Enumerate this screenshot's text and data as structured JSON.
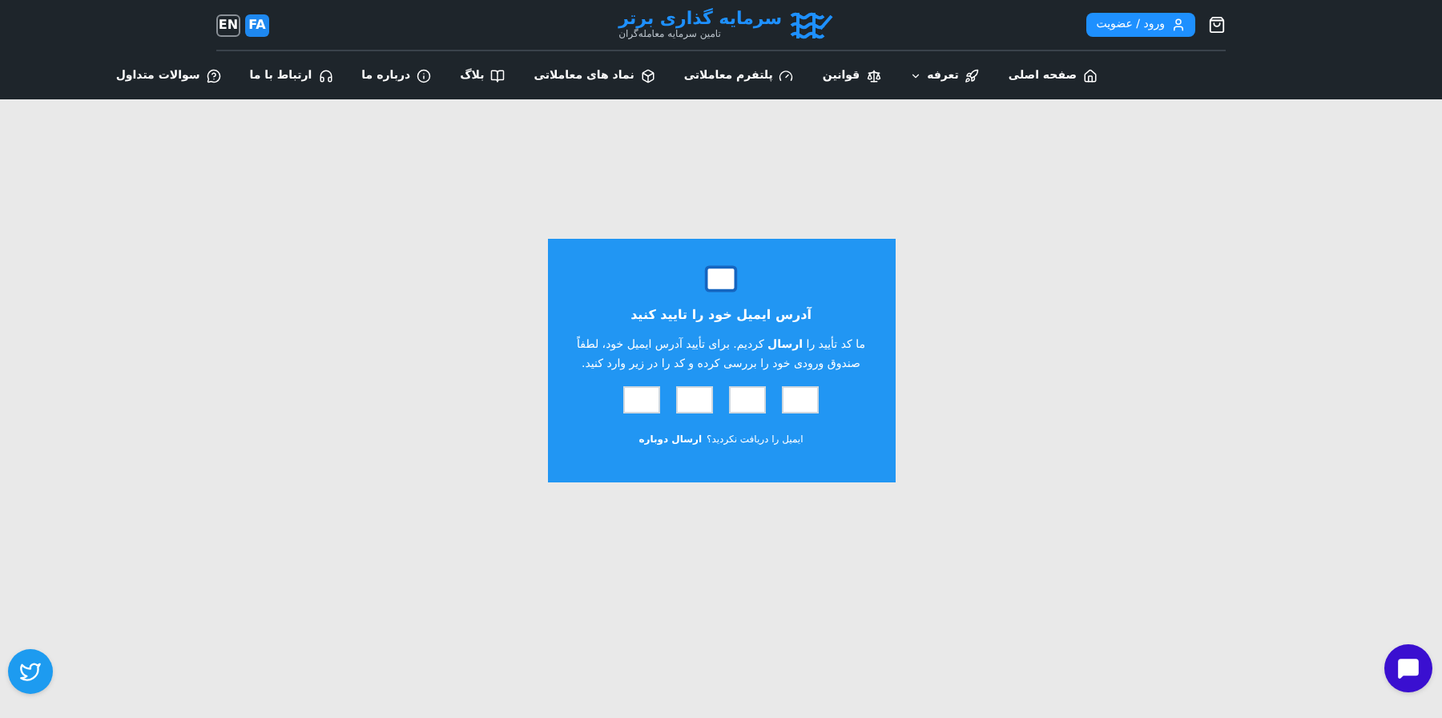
{
  "header": {
    "languages": [
      {
        "label": "FA",
        "selected": true
      },
      {
        "label": "EN",
        "selected": false
      }
    ],
    "logo": {
      "name": "سرمایه گذاری برتر",
      "tagline": "تامین سرمایه معامله‌گران"
    },
    "login_button": "ورود / عضویت"
  },
  "nav": [
    {
      "label": "صفحه اصلی",
      "kind": "home",
      "has_menu": false
    },
    {
      "label": "تعرفه",
      "kind": "rocket",
      "has_menu": true
    },
    {
      "label": "قوانین",
      "kind": "scale",
      "has_menu": false
    },
    {
      "label": "پلتفرم معاملاتی",
      "kind": "gauge",
      "has_menu": false
    },
    {
      "label": "نماد های معاملاتی",
      "kind": "box",
      "has_menu": false
    },
    {
      "label": "بلاگ",
      "kind": "book",
      "has_menu": false
    },
    {
      "label": "درباره ما",
      "kind": "info",
      "has_menu": false
    },
    {
      "label": "ارتباط با ما",
      "kind": "headphones",
      "has_menu": false
    },
    {
      "label": "سوالات متداول",
      "kind": "question",
      "has_menu": false
    }
  ],
  "verify_card": {
    "title": "آدرس ایمیل خود را تایید کنید",
    "message": "ما کد تأیید را **ارسال** کردیم. برای تأیید آدرس ایمیل خود، لطفاً صندوق ورودی خود را بررسی کرده و کد را در زیر وارد کنید.",
    "resend_prompt": "ایمیل را دریافت نکردید؟",
    "resend_link": "ارسال دوباره"
  }
}
